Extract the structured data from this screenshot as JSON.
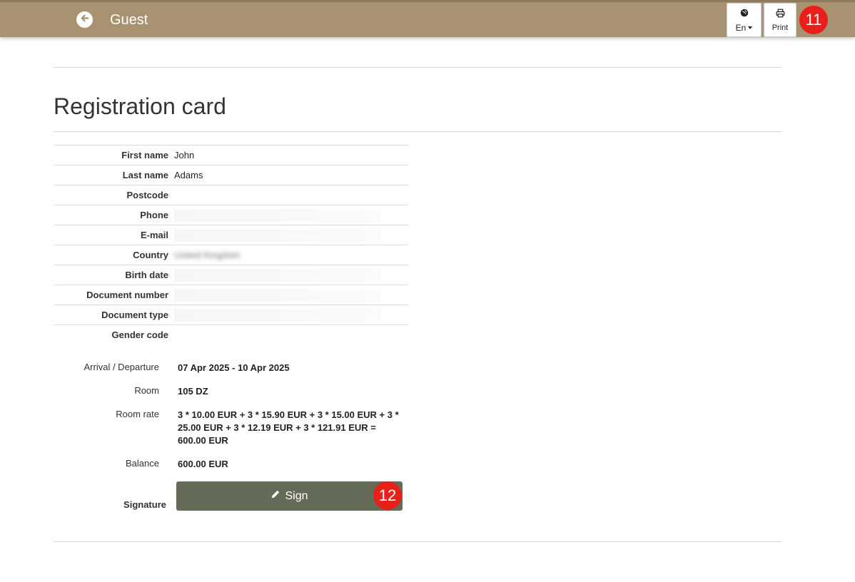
{
  "header": {
    "title": "Guest",
    "language_label": "En",
    "print_label": "Print",
    "badge_print": "11"
  },
  "page": {
    "heading": "Registration card"
  },
  "guest": {
    "rows": [
      {
        "label": "First name",
        "value": "John"
      },
      {
        "label": "Last name",
        "value": "Adams"
      },
      {
        "label": "Postcode",
        "value": ""
      },
      {
        "label": "Phone",
        "value": ""
      },
      {
        "label": "E-mail",
        "value": ""
      },
      {
        "label": "Country",
        "value": "United Kingdom"
      },
      {
        "label": "Birth date",
        "value": ""
      },
      {
        "label": "Document number",
        "value": ""
      },
      {
        "label": "Document type",
        "value": ""
      },
      {
        "label": "Gender code",
        "value": ""
      }
    ]
  },
  "stay": {
    "arrival_label": "Arrival / Departure",
    "arrival_value": "07 Apr 2025 - 10 Apr 2025",
    "room_label": "Room",
    "room_value": "105 DZ",
    "rate_label": "Room rate",
    "rate_value": "3 * 10.00 EUR + 3 * 15.90 EUR + 3 * 15.00 EUR + 3 * 25.00 EUR + 3 * 12.19 EUR + 3 * 121.91 EUR = 600.00 EUR",
    "balance_label": "Balance",
    "balance_value": "600.00 EUR"
  },
  "signature": {
    "label": "Signature",
    "button_label": "Sign",
    "badge": "12"
  },
  "colors": {
    "topbar": "#a89272",
    "sign_button": "#646c58",
    "badge": "#e8201a"
  }
}
